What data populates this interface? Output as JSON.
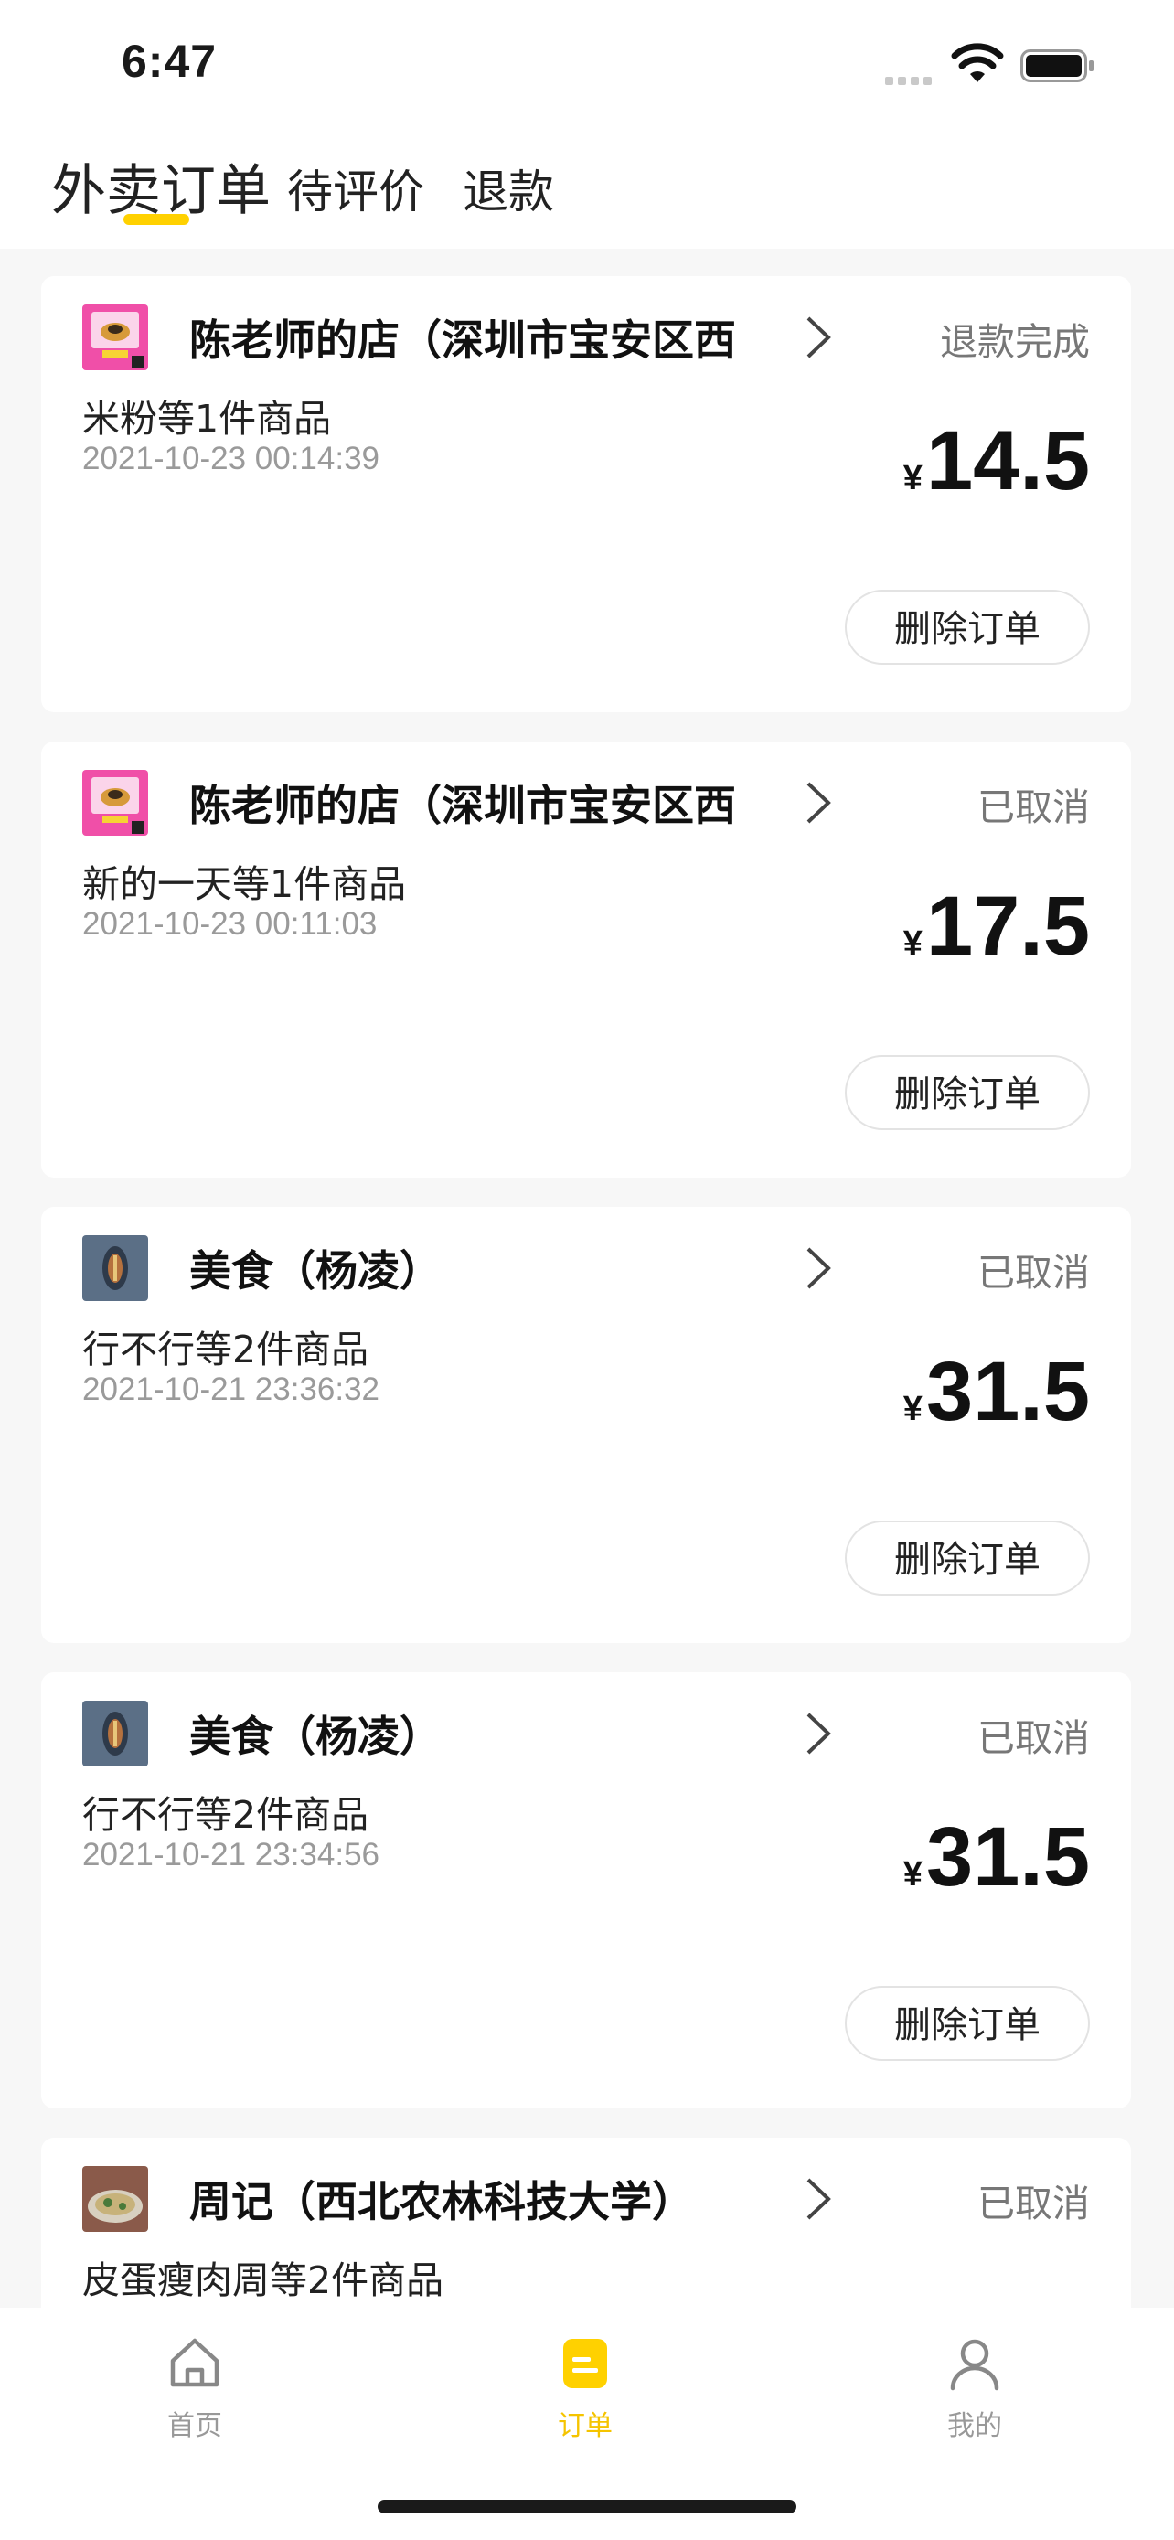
{
  "status_bar": {
    "time": "6:47"
  },
  "header": {
    "tabs": [
      {
        "label": "外卖订单",
        "active": true
      },
      {
        "label": "待评价",
        "active": false
      },
      {
        "label": "退款",
        "active": false
      }
    ]
  },
  "orders": [
    {
      "shop": "陈老师的店（深圳市宝安区西",
      "status": "退款完成",
      "items": "米粉等1件商品",
      "datetime": "2021-10-23 00:14:39",
      "currency": "¥",
      "price": "14.5",
      "action": "删除订单",
      "thumb": "pink-shop-logo"
    },
    {
      "shop": "陈老师的店（深圳市宝安区西",
      "status": "已取消",
      "items": "新的一天等1件商品",
      "datetime": "2021-10-23 00:11:03",
      "currency": "¥",
      "price": "17.5",
      "action": "删除订单",
      "thumb": "pink-shop-logo"
    },
    {
      "shop": "美食（杨凌）",
      "status": "已取消",
      "items": "行不行等2件商品",
      "datetime": "2021-10-21 23:36:32",
      "currency": "¥",
      "price": "31.5",
      "action": "删除订单",
      "thumb": "blue-shop-logo"
    },
    {
      "shop": "美食（杨凌）",
      "status": "已取消",
      "items": "行不行等2件商品",
      "datetime": "2021-10-21 23:34:56",
      "currency": "¥",
      "price": "31.5",
      "action": "删除订单",
      "thumb": "blue-shop-logo"
    },
    {
      "shop": "周记（西北农林科技大学）",
      "status": "已取消",
      "items": "皮蛋瘦肉周等2件商品",
      "datetime": "",
      "currency": "",
      "price": "",
      "action": "",
      "thumb": "food-photo"
    }
  ],
  "bottom_nav": [
    {
      "label": "首页",
      "icon": "home-icon",
      "active": false
    },
    {
      "label": "订单",
      "icon": "orders-icon",
      "active": true
    },
    {
      "label": "我的",
      "icon": "profile-icon",
      "active": false
    }
  ],
  "colors": {
    "accent": "#ffd100",
    "active_nav": "#f5c400"
  }
}
